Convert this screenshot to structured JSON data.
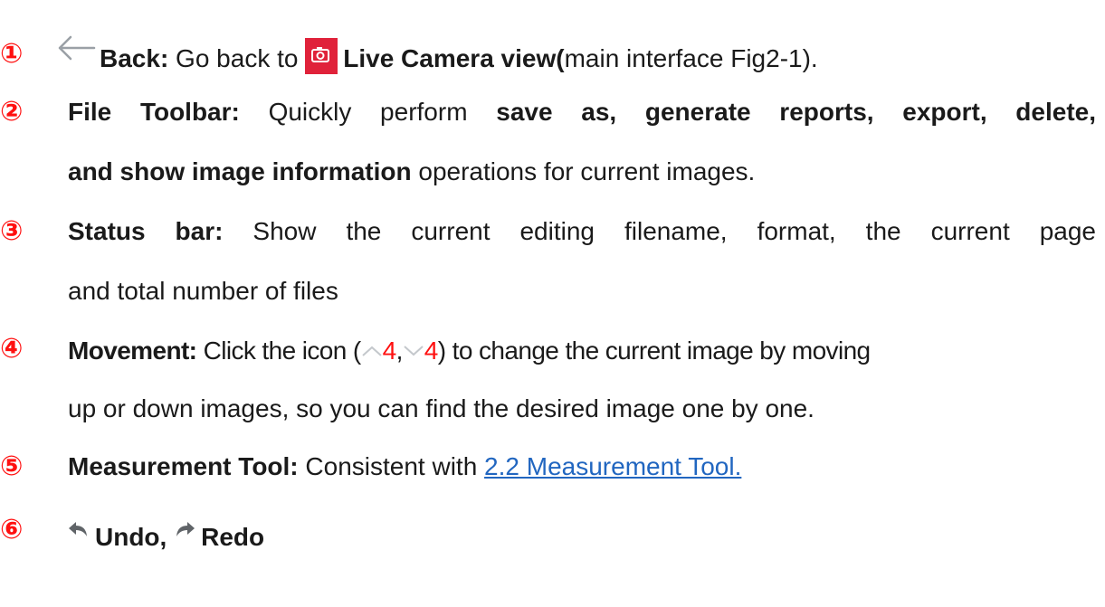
{
  "items": [
    {
      "number": "①",
      "back_label": "Back",
      "colon": ":",
      "go_back_text": " Go back to ",
      "live_camera_label": "Live Camera view(",
      "live_camera_rest": "main interface Fig2-1)."
    },
    {
      "number": "②",
      "title": "File Toolbar:",
      "text1": " Quickly perform ",
      "bold_ops_line1": "save as, generate reports, export, delete,",
      "bold_ops_line2": "and show image information",
      "text2": " operations for current images."
    },
    {
      "number": "③",
      "title": "Status bar:",
      "text1": " Show the current editing filename, format, the current page",
      "text2": "and total number of files"
    },
    {
      "number": "④",
      "title": "Movement:",
      "text1": " Click the icon (",
      "up_value": "4",
      "comma": ",",
      "down_value": "4",
      "text2": ") to change the current image by moving",
      "text3": "up or down images, so you can find the desired image one by one."
    },
    {
      "number": "⑤",
      "title": "Measurement Tool:",
      "text1": " Consistent with ",
      "link": "2.2 Measurement Tool."
    },
    {
      "number": "⑥",
      "undo_label": "Undo,",
      "redo_label": "Redo"
    }
  ],
  "icons": {
    "back": "back-arrow-icon",
    "live_camera": "camera-icon",
    "up": "chevron-up-icon",
    "down": "chevron-down-icon",
    "undo": "undo-icon",
    "redo": "redo-icon"
  },
  "colors": {
    "number": "#ff1010",
    "link": "#2166c0",
    "camera_bg": "#e0223a",
    "arrow_gray": "#9aa0a6"
  }
}
